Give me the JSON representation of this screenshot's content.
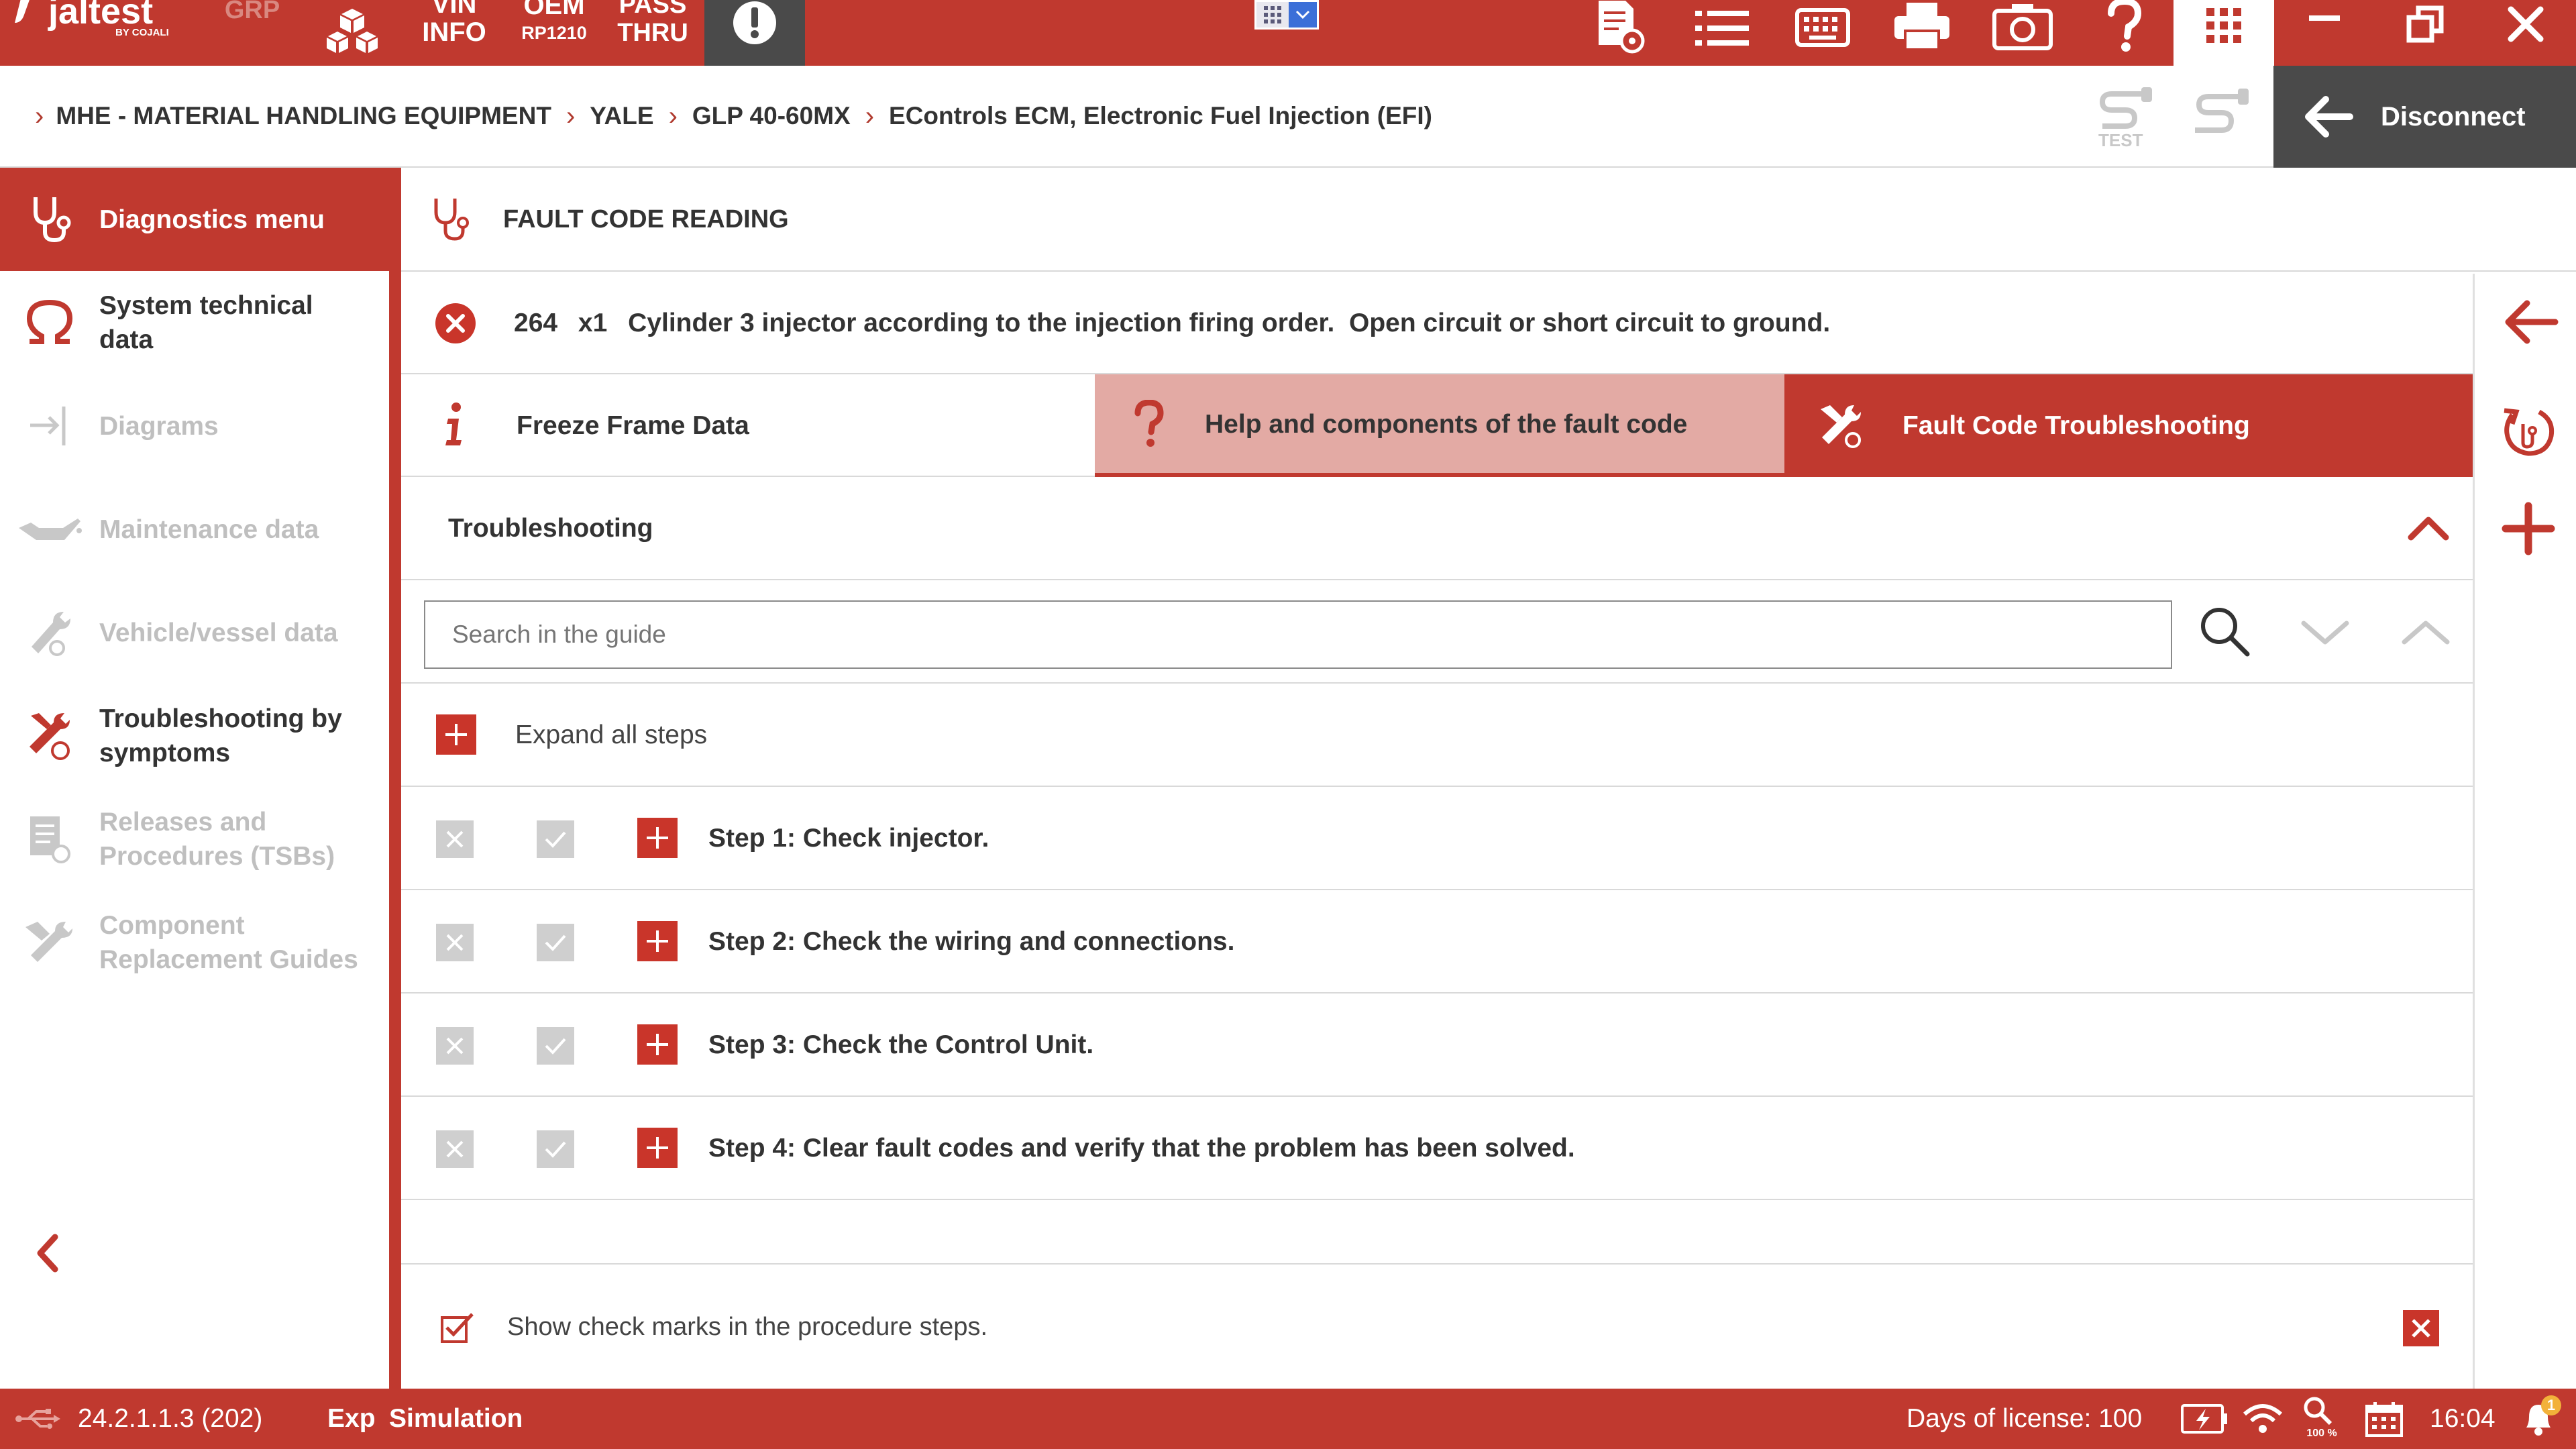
{
  "app": {
    "brand": "jaltest",
    "brand_sub": "BY COJALI",
    "grp": "GRP",
    "vin_line1": "VIN",
    "vin_line2": "INFO",
    "oem_line1": "OEM",
    "oem_line2": "RP1210",
    "pass_line1": "PASS",
    "pass_line2": "THRU"
  },
  "breadcrumb": [
    "MHE - MATERIAL HANDLING EQUIPMENT",
    "YALE",
    "GLP 40-60MX",
    "EControls ECM, Electronic Fuel Injection (EFI)"
  ],
  "header_tools": {
    "test_label": "TEST"
  },
  "disconnect_label": "Disconnect",
  "sidebar": {
    "title": "Diagnostics menu",
    "items": [
      {
        "line1": "System technical",
        "line2": "data",
        "enabled": true
      },
      {
        "line1": "Diagrams",
        "line2": "",
        "enabled": false
      },
      {
        "line1": "Maintenance data",
        "line2": "",
        "enabled": false
      },
      {
        "line1": "Vehicle/vessel data",
        "line2": "",
        "enabled": false
      },
      {
        "line1": "Troubleshooting by",
        "line2": "symptoms",
        "enabled": true
      },
      {
        "line1": "Releases and",
        "line2": "Procedures (TSBs)",
        "enabled": false
      },
      {
        "line1": "Component",
        "line2": "Replacement Guides",
        "enabled": false
      }
    ]
  },
  "section_title": "FAULT CODE READING",
  "fault": {
    "code": "264",
    "count": "x1",
    "description": "Cylinder 3 injector according to the injection firing order.  Open circuit or short circuit to ground."
  },
  "tabs": [
    {
      "label": "Freeze Frame Data",
      "state": "normal"
    },
    {
      "label": "Help and components of the fault code",
      "state": "hover"
    },
    {
      "label": "Fault Code Troubleshooting",
      "state": "active"
    }
  ],
  "troubleshooting": {
    "title": "Troubleshooting",
    "search_placeholder": "Search in the guide",
    "expand_all": "Expand all steps",
    "steps": [
      "Step 1: Check injector.",
      "Step 2: Check the wiring and connections.",
      "Step 3: Check the Control Unit.",
      "Step 4: Clear fault codes and verify that the problem has been solved."
    ],
    "show_checkmarks_label": "Show check marks in the procedure steps.",
    "show_checkmarks": true
  },
  "status": {
    "version": "24.2.1.1.3 (202)",
    "mode_prefix": "Exp",
    "mode": "Simulation",
    "license": "Days of license: 100",
    "zoom": "100 %",
    "time": "16:04",
    "notification_count": "1"
  },
  "colors": {
    "brand_red": "#c0392f",
    "hover_tab": "#e3aaa4",
    "dark_panel": "#4a4a4a",
    "disabled_gray": "#bfbfbf"
  }
}
